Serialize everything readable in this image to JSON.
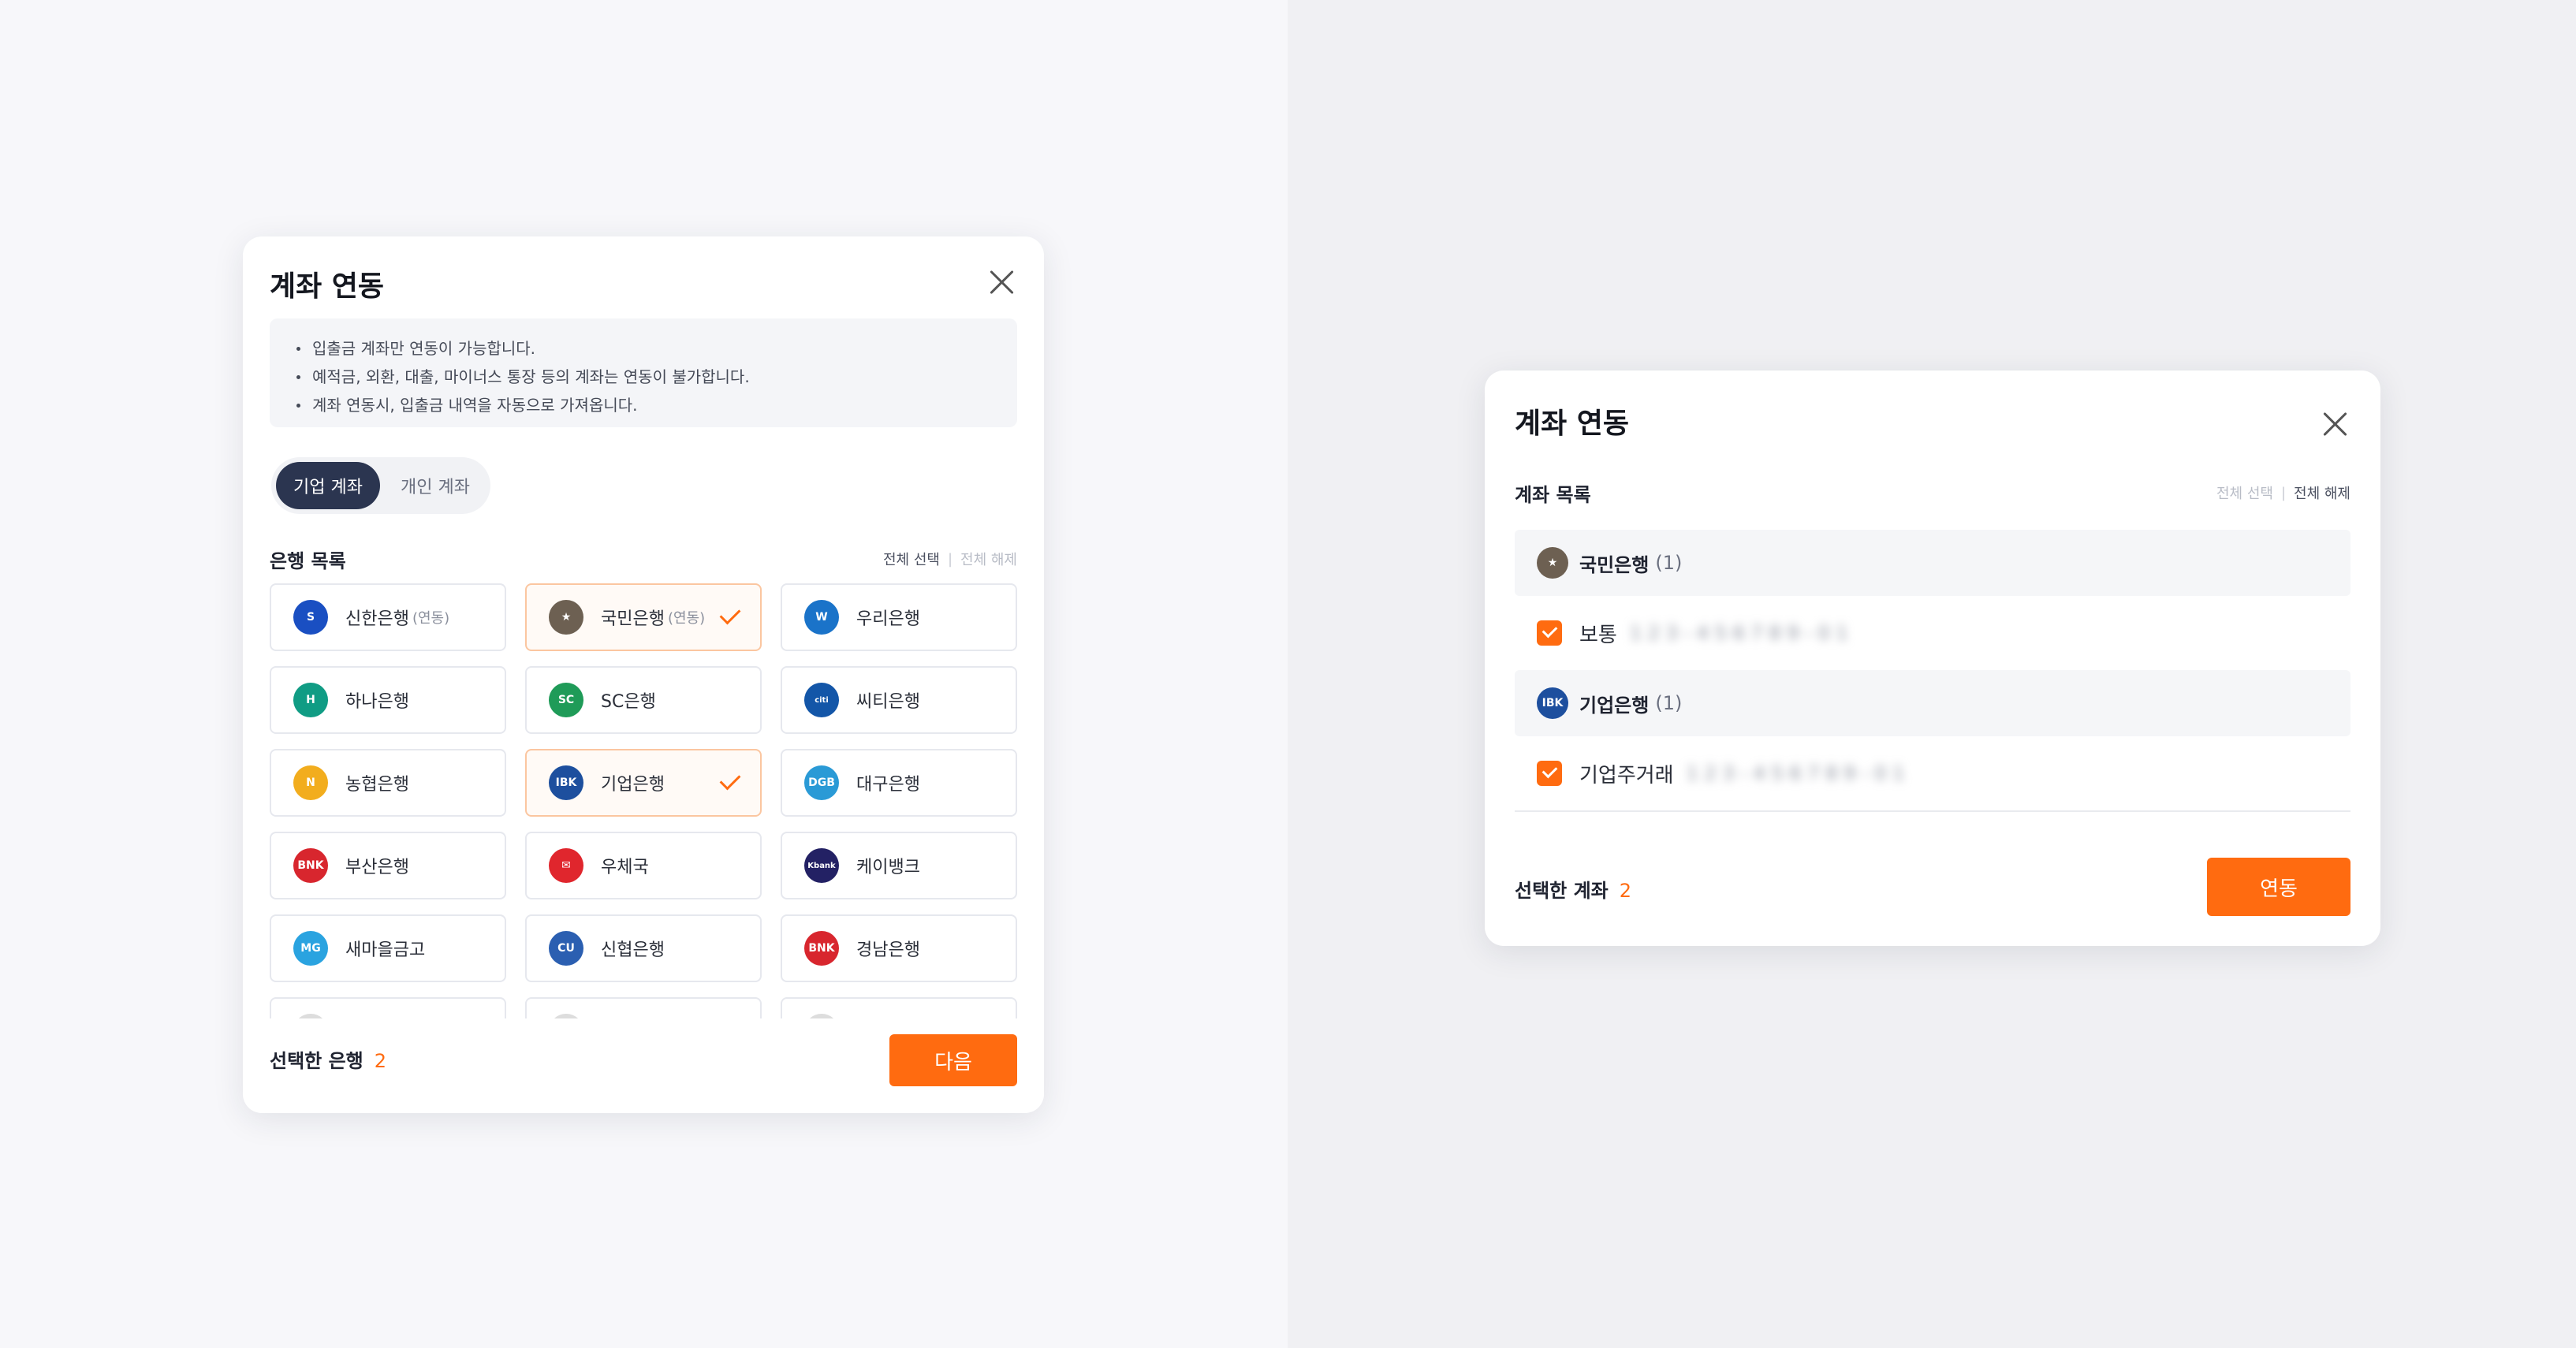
{
  "left_modal": {
    "title": "계좌 연동",
    "notice": [
      "입출금 계좌만 연동이 가능합니다.",
      "예적금, 외환, 대출, 마이너스 통장 등의 계좌는 연동이 불가합니다.",
      "계좌 연동시, 입출금 내역을 자동으로 가져옵니다."
    ],
    "tabs": {
      "corporate": "기업 계좌",
      "personal": "개인 계좌"
    },
    "bank_list_title": "은행 목록",
    "select_all": "전체 선택",
    "deselect_all": "전체 해제",
    "banks": [
      {
        "name": "신한은행",
        "tag": "(연동)",
        "selected": false,
        "color": "#1a4fc2",
        "logo_text": "S"
      },
      {
        "name": "국민은행",
        "tag": "(연동)",
        "selected": true,
        "color": "#6d6052",
        "logo_text": "★"
      },
      {
        "name": "우리은행",
        "tag": "",
        "selected": false,
        "color": "#1a73c9",
        "logo_text": "W"
      },
      {
        "name": "하나은행",
        "tag": "",
        "selected": false,
        "color": "#109c84",
        "logo_text": "H"
      },
      {
        "name": "SC은행",
        "tag": "",
        "selected": false,
        "color": "#1f9b58",
        "logo_text": "SC"
      },
      {
        "name": "씨티은행",
        "tag": "",
        "selected": false,
        "color": "#1356a8",
        "logo_text": "citi"
      },
      {
        "name": "농협은행",
        "tag": "",
        "selected": false,
        "color": "#f2ad1e",
        "logo_text": "N"
      },
      {
        "name": "기업은행",
        "tag": "",
        "selected": true,
        "color": "#1d4f9e",
        "logo_text": "IBK"
      },
      {
        "name": "대구은행",
        "tag": "",
        "selected": false,
        "color": "#2a9ad6",
        "logo_text": "DGB"
      },
      {
        "name": "부산은행",
        "tag": "",
        "selected": false,
        "color": "#d8262e",
        "logo_text": "BNK"
      },
      {
        "name": "우체국",
        "tag": "",
        "selected": false,
        "color": "#e0262d",
        "logo_text": "✉"
      },
      {
        "name": "케이뱅크",
        "tag": "",
        "selected": false,
        "color": "#232164",
        "logo_text": "Kbank"
      },
      {
        "name": "새마을금고",
        "tag": "",
        "selected": false,
        "color": "#2aa3e0",
        "logo_text": "MG"
      },
      {
        "name": "신협은행",
        "tag": "",
        "selected": false,
        "color": "#2b5fb1",
        "logo_text": "CU"
      },
      {
        "name": "경남은행",
        "tag": "",
        "selected": false,
        "color": "#d8262e",
        "logo_text": "BNK"
      },
      {
        "name": "",
        "tag": "",
        "selected": false,
        "color": "#dddddd",
        "logo_text": ""
      },
      {
        "name": "",
        "tag": "",
        "selected": false,
        "color": "#dddddd",
        "logo_text": ""
      },
      {
        "name": "",
        "tag": "",
        "selected": false,
        "color": "#dddddd",
        "logo_text": ""
      }
    ],
    "footer_label": "선택한 은행",
    "footer_count": "2",
    "next_button": "다음"
  },
  "right_modal": {
    "title": "계좌 연동",
    "account_list_title": "계좌 목록",
    "select_all": "전체 선택",
    "deselect_all": "전체 해제",
    "groups": [
      {
        "bank": "국민은행",
        "count": "(1)",
        "color": "#6d6052",
        "logo_text": "★",
        "account_type": "보통",
        "account_number": "1 2 3 - 4 5 6 7 8 9 - 0 1"
      },
      {
        "bank": "기업은행",
        "count": "(1)",
        "color": "#1d4f9e",
        "logo_text": "IBK",
        "account_type": "기업주거래",
        "account_number": "1 2 3 - 4 5 6 7 8 9 - 0 1"
      }
    ],
    "footer_label": "선택한 계좌",
    "footer_count": "2",
    "link_button": "연동"
  },
  "colors": {
    "accent": "#ff6b10",
    "navy": "#2b3550",
    "selected_border": "#fbc6a0"
  }
}
